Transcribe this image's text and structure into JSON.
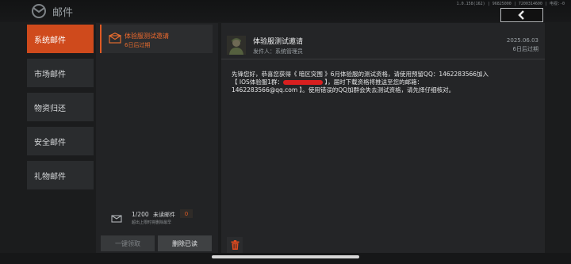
{
  "header": {
    "title": "邮件",
    "sysinfo": "1.0.158(162) | 96825000 | 7200314600 | 电视:-0"
  },
  "sidebar": {
    "items": [
      {
        "label": "系统邮件",
        "active": true
      },
      {
        "label": "市场邮件",
        "active": false
      },
      {
        "label": "物资归还",
        "active": false
      },
      {
        "label": "安全邮件",
        "active": false
      },
      {
        "label": "礼物邮件",
        "active": false
      }
    ]
  },
  "mail_list": {
    "items": [
      {
        "title": "体验服测试邀请",
        "expires": "6日后过期"
      }
    ]
  },
  "mailbox": {
    "count": "1/200",
    "unread_label": "未读邮件",
    "unread_count": "0",
    "note": "超出上限时将删除最早"
  },
  "actions": {
    "claim_all": "一键领取",
    "delete_read": "删除已读"
  },
  "mail": {
    "title": "体验服测试邀请",
    "sender": "发件人：系统管理员",
    "date": "2025.06.03",
    "expires": "6日后过期",
    "body_1": "先锋您好，恭喜您获得《 暗区突围 》6月体验服的测试资格，请使用预留QQ：1462283566加入",
    "body_2a": "【 IOS体验服1群：",
    "body_2b": " 】，届时下载资格将推送至您的邮箱：",
    "body_3": "1462283566@qq.com 】。使用错误的QQ加群会失去测试资格，请先择仔细核对。"
  },
  "colors": {
    "accent": "#cf4a1c",
    "accent_text": "#f06a2e",
    "redaction": "#d81f1f"
  }
}
